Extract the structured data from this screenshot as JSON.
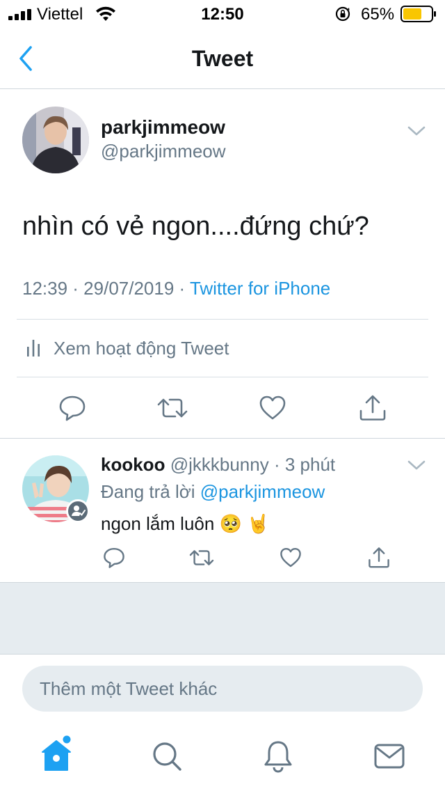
{
  "status_bar": {
    "carrier": "Viettel",
    "time": "12:50",
    "battery_percent": "65%"
  },
  "nav": {
    "title": "Tweet",
    "back_icon": "chevron-left-icon"
  },
  "main_tweet": {
    "display_name": "parkjimmeow",
    "handle": "@parkjimmeow",
    "text": "nhìn có vẻ ngon....đứng chứ?",
    "timestamp": "12:39 · 29/07/2019 · ",
    "source": "Twitter for iPhone",
    "activity_label": "Xem hoạt động Tweet",
    "actions": [
      "reply-icon",
      "retweet-icon",
      "like-icon",
      "share-icon"
    ]
  },
  "reply": {
    "display_name": "kookoo",
    "handle": "@jkkkbunny",
    "separator": "·",
    "time": "3 phút",
    "replying_to_prefix": "Đang trả lời ",
    "replying_to_mention": "@parkjimmeow",
    "text": "ngon lắm luôn 🥺 🤘"
  },
  "compose": {
    "placeholder": "Thêm một Tweet khác"
  },
  "tab_bar": {
    "items": [
      "home-icon",
      "search-icon",
      "notifications-icon",
      "messages-icon"
    ]
  },
  "colors": {
    "accent": "#1DA1F2",
    "link": "#1B95E0",
    "secondary_text": "#657786",
    "background_gray": "#E6ECF0",
    "battery": "#F9C600"
  }
}
